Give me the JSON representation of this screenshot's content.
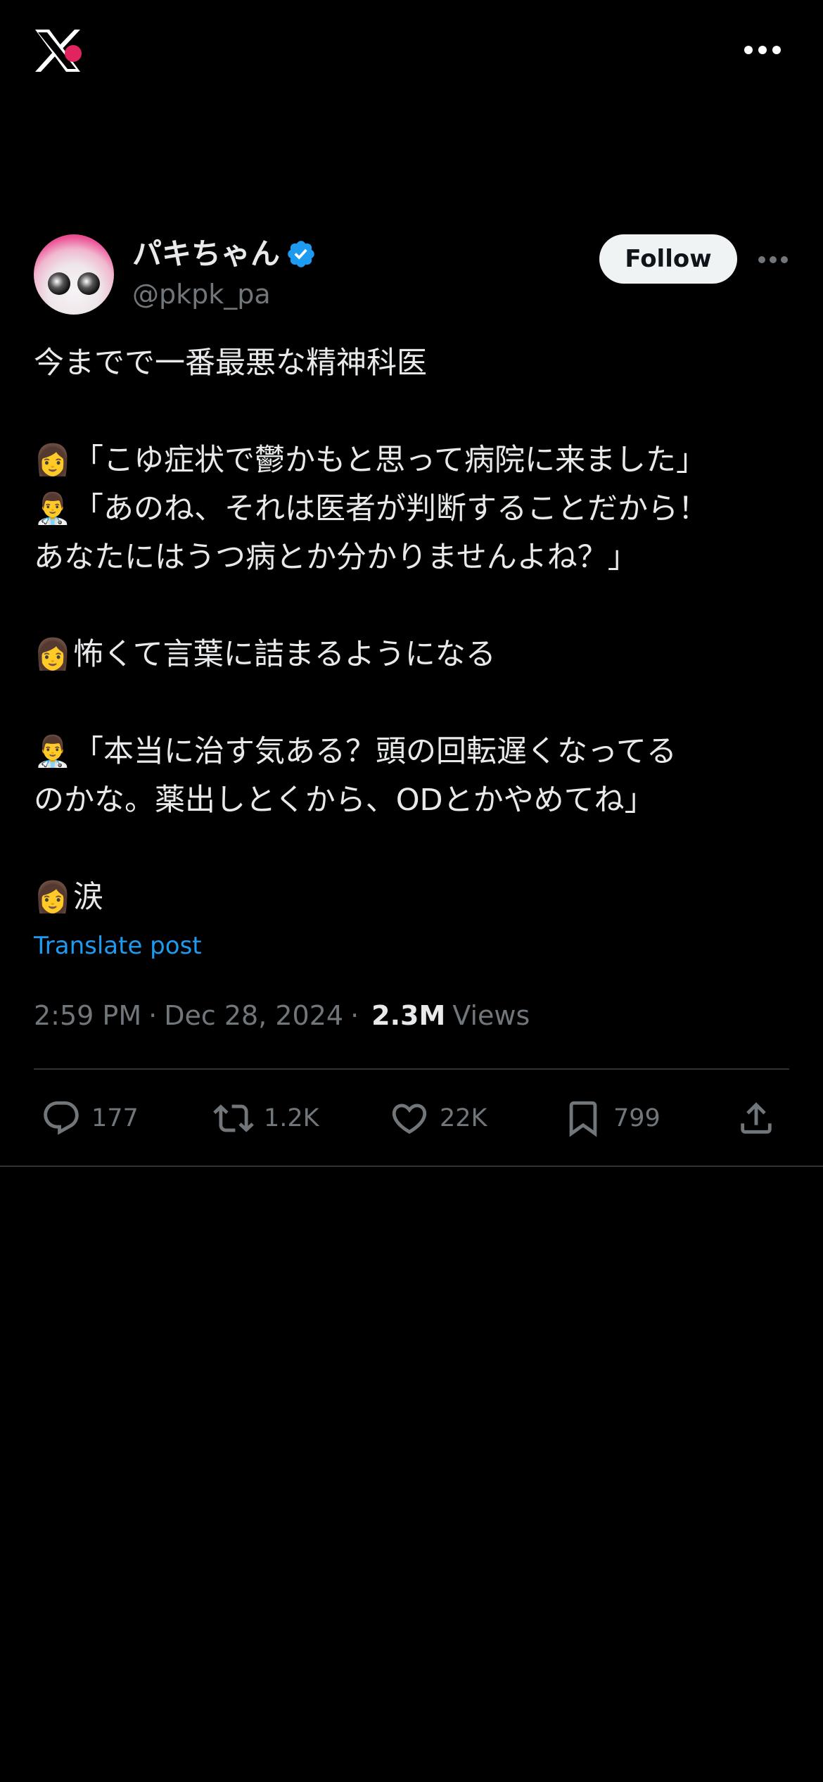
{
  "app": {
    "logo_icon": "x-logo-icon",
    "more_icon": "more-horizontal-icon"
  },
  "author": {
    "display_name": "パキちゃん",
    "handle": "@pkpk_pa",
    "verified": true,
    "follow_label": "Follow"
  },
  "tweet": {
    "lines": [
      {
        "emoji": "",
        "text": "今までで一番最悪な精神科医"
      },
      {
        "emoji": "",
        "text": ""
      },
      {
        "emoji": "👩",
        "text": "「こゆ症状で鬱かもと思って病院に来ました」"
      },
      {
        "emoji": "👨‍⚕️",
        "text": "「あのね、それは医者が判断することだから！"
      },
      {
        "emoji": "",
        "text": "あなたにはうつ病とか分かりませんよね？」"
      },
      {
        "emoji": "",
        "text": ""
      },
      {
        "emoji": "👩",
        "text": "怖くて言葉に詰まるようになる"
      },
      {
        "emoji": "",
        "text": ""
      },
      {
        "emoji": "👨‍⚕️",
        "text": "「本当に治す気ある？頭の回転遅くなってる"
      },
      {
        "emoji": "",
        "text": "のかな。薬出しとくから、ODとかやめてね」"
      },
      {
        "emoji": "",
        "text": ""
      },
      {
        "emoji": "👩",
        "text": "涙"
      }
    ],
    "translate_label": "Translate post",
    "time": "2:59 PM",
    "date": "Dec 28, 2024",
    "separator": "·",
    "views_count": "2.3M",
    "views_label": "Views"
  },
  "actions": {
    "replies": "177",
    "reposts": "1.2K",
    "likes": "22K",
    "bookmarks": "799"
  },
  "colors": {
    "background": "#000000",
    "text_primary": "#e7e9ea",
    "text_secondary": "#71767b",
    "link": "#1d9bf0",
    "verified": "#1d9bf0",
    "divider": "#2f3336"
  }
}
